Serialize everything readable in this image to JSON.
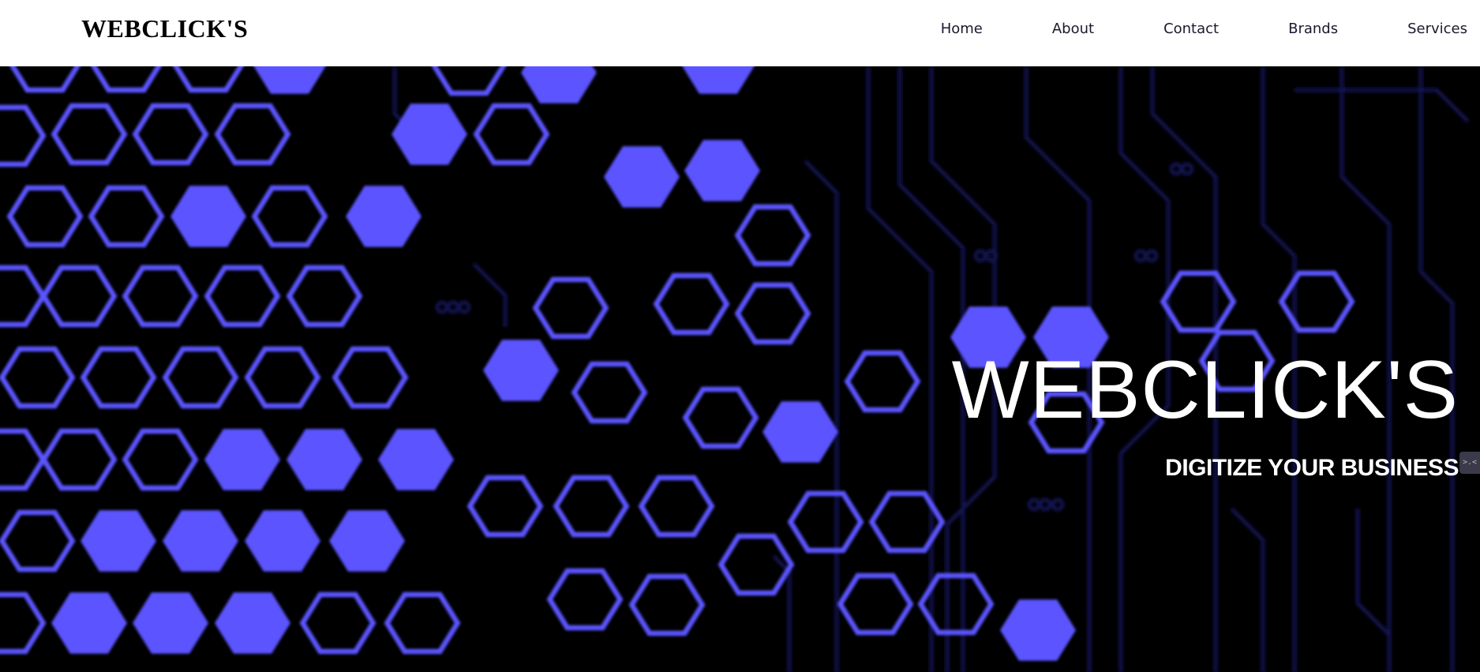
{
  "header": {
    "brand": "WEBCLICK'S",
    "nav": [
      {
        "label": "Home"
      },
      {
        "label": "About"
      },
      {
        "label": "Contact"
      },
      {
        "label": "Brands"
      },
      {
        "label": "Services"
      }
    ]
  },
  "hero": {
    "title": "WEBCLICK'S",
    "subtitle": "DIGITIZE YOUR BUSINESS",
    "background": "hexagon-circuit-pattern",
    "colors": {
      "hex": "#5b55ff",
      "circuit": "#15155a",
      "base": "#000000"
    }
  },
  "widget": {
    "icon": "chat-widget-icon",
    "glyph": ">.<"
  }
}
